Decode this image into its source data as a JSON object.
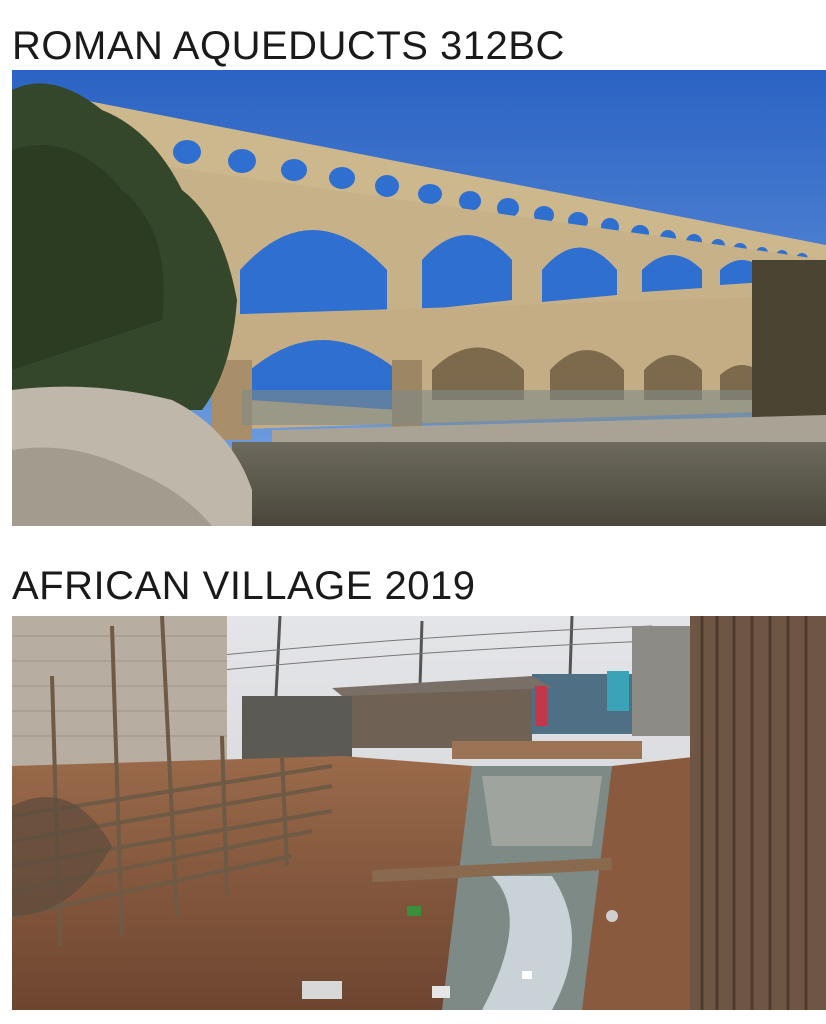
{
  "captions": {
    "top": "ROMAN AQUEDUCTS 312BC",
    "bottom": "AFRICAN VILLAGE 2019"
  },
  "photos": {
    "top": {
      "subject": "roman-aqueduct-bridge-photo",
      "colors": {
        "sky": "#2f6fd0",
        "stone": "#c9b48a",
        "stone_shadow": "#8c7655",
        "water": "#5d5a4f",
        "trees": "#3b4d2c",
        "rocks": "#b9b2a4"
      }
    },
    "bottom": {
      "subject": "village-open-drain-photo",
      "colors": {
        "sky": "#dcdde0",
        "dirt": "#8a5a3e",
        "wall": "#b7aea3",
        "shack": "#6e5a4a",
        "water": "#c9d2d6",
        "fence": "#7a6957"
      }
    }
  }
}
